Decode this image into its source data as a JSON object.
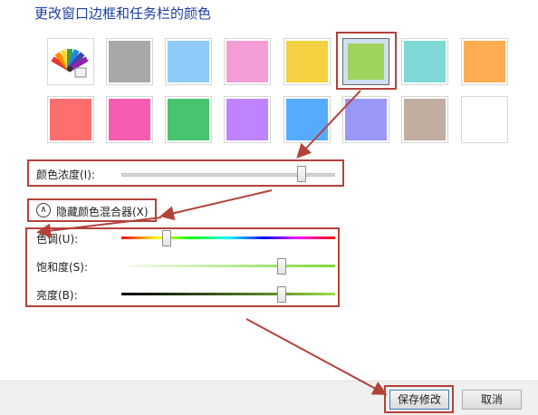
{
  "window": {
    "title": "更改窗口边框和任务栏的颜色"
  },
  "colors": {
    "row1": [
      "custom",
      "#a8a8a8",
      "#8ecbf8",
      "#f39dd4",
      "#f3d141",
      "#9fd45c",
      "#7fd8d6",
      "#ffac52"
    ],
    "row2": [
      "#ff6e6e",
      "#f75ab1",
      "#47c56e",
      "#c083ff",
      "#57abff",
      "#9a98f6",
      "#c2ada1",
      "#ffffff"
    ],
    "selected_row": 1,
    "selected_index": 5,
    "annotation": "#b3423a"
  },
  "intensity": {
    "label": "颜色浓度(I):",
    "value": 0.86
  },
  "mixer": {
    "toggle_label": "隐藏颜色混合器(X)",
    "hue": {
      "label": "色调(U):",
      "value": 0.2
    },
    "saturation": {
      "label": "饱和度(S):",
      "value": 0.76
    },
    "brightness": {
      "label": "亮度(B):",
      "value": 0.76
    }
  },
  "footer": {
    "save_label": "保存修改",
    "cancel_label": "取消"
  }
}
